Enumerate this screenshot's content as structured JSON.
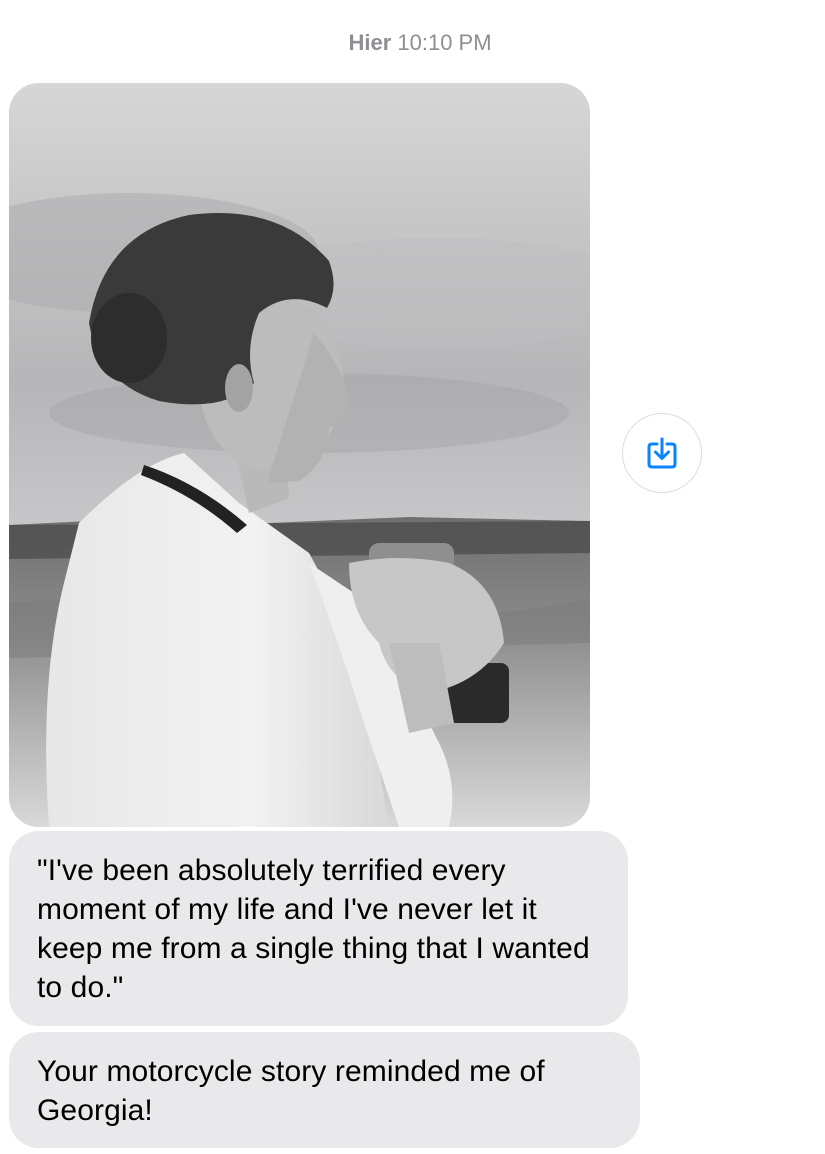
{
  "conversation": {
    "timestamp_day": "Hier",
    "timestamp_time": "10:10 PM"
  },
  "photo_message": {
    "save_icon": "square-arrow-down-icon",
    "accent_color": "#0a84ff"
  },
  "messages": [
    {
      "text": "\"I've been absolutely terrified every moment of my life and I've never let it keep me from a single thing that I wanted to do.\""
    },
    {
      "text": "Your motorcycle story reminded me of Georgia!"
    }
  ],
  "colors": {
    "bubble_incoming": "#e9e9eb",
    "timestamp": "#8e8e93"
  }
}
